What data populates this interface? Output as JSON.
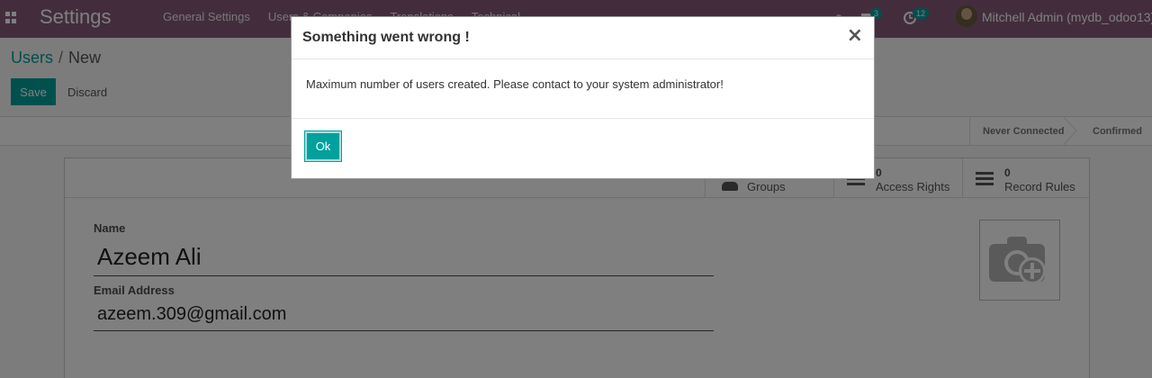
{
  "navbar": {
    "app_title": "Settings",
    "menu": [
      "General Settings",
      "Users & Companies",
      "Translations",
      "Technical"
    ],
    "messages_count": "3",
    "activities_count": "12",
    "user_name": "Mitchell Admin (mydb_odoo13)"
  },
  "breadcrumb": {
    "parent": "Users",
    "separator": "/",
    "current": "New"
  },
  "buttons": {
    "save": "Save",
    "discard": "Discard"
  },
  "statusbar": {
    "steps": [
      "Never Connected",
      "Confirmed"
    ]
  },
  "smart_buttons": [
    {
      "count": "",
      "label": "Groups"
    },
    {
      "count": "0",
      "label": "Access Rights"
    },
    {
      "count": "0",
      "label": "Record Rules"
    }
  ],
  "form": {
    "name_label": "Name",
    "name_value": "Azeem Ali",
    "email_label": "Email Address",
    "email_value": "azeem.309@gmail.com"
  },
  "dialog": {
    "title": "Something went wrong !",
    "close_symbol": "×",
    "message": "Maximum number of users created. Please contact to your system administrator!",
    "ok_label": "Ok"
  },
  "colors": {
    "navbar": "#875a7b",
    "primary": "#00a09d"
  }
}
